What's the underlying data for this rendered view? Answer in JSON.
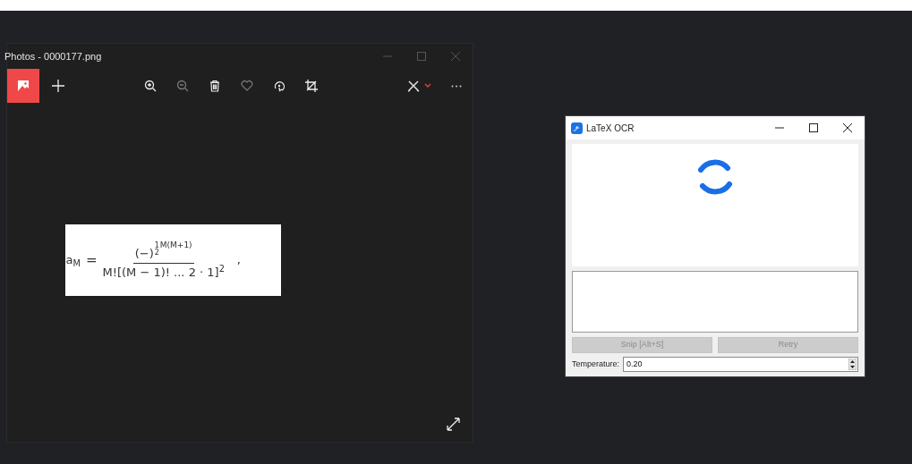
{
  "photos_window": {
    "title": "Photos - 0000177.png",
    "toolbar": [
      {
        "kind": "zoom-in",
        "disabled": false
      },
      {
        "kind": "zoom-out",
        "disabled": true
      },
      {
        "kind": "delete",
        "disabled": false
      },
      {
        "kind": "favorite",
        "disabled": true
      },
      {
        "kind": "rotate",
        "disabled": false
      },
      {
        "kind": "crop",
        "disabled": false
      }
    ],
    "image": {
      "lhs_base": "a",
      "lhs_sub": "M",
      "equals": "=",
      "num_base": "(−)",
      "exp_num": "1",
      "exp_den": "2",
      "exp_rest": "M(M+1)",
      "denominator": "M![(M − 1)! ... 2 · 1]$^{2}$",
      "trail": ","
    }
  },
  "ocr_window": {
    "title": "LaTeX OCR",
    "loading": true,
    "buttons": [
      {
        "label": "Snip [Alt+S]",
        "disabled": true
      },
      {
        "label": "Retry",
        "disabled": true
      }
    ],
    "temperature": {
      "label": "Temperature:",
      "value": "0.20"
    }
  }
}
